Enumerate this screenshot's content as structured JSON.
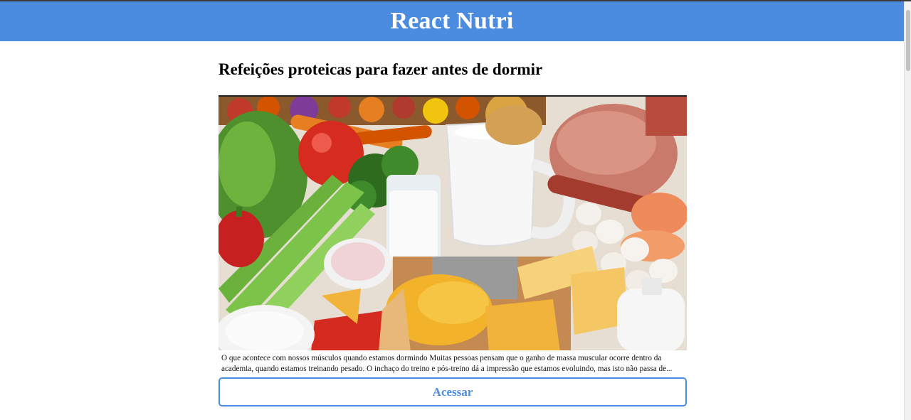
{
  "app": {
    "title": "React Nutri"
  },
  "colors": {
    "header_bg": "#4b8be0",
    "accent": "#4b8be0",
    "background": "#ffffff"
  },
  "post": {
    "title": "Refeições proteicas para fazer antes de dormir",
    "image_alt": "",
    "excerpt": "O que acontece com nossos músculos quando estamos dormindo Muitas pessoas pensam que o ganho de massa muscular ocorre dentro da academia, quando estamos treinando pesado. O inchaço do treino e pós-treino dá a impressão que estamos evoluindo, mas isto não passa de...",
    "button_label": "Acessar"
  }
}
